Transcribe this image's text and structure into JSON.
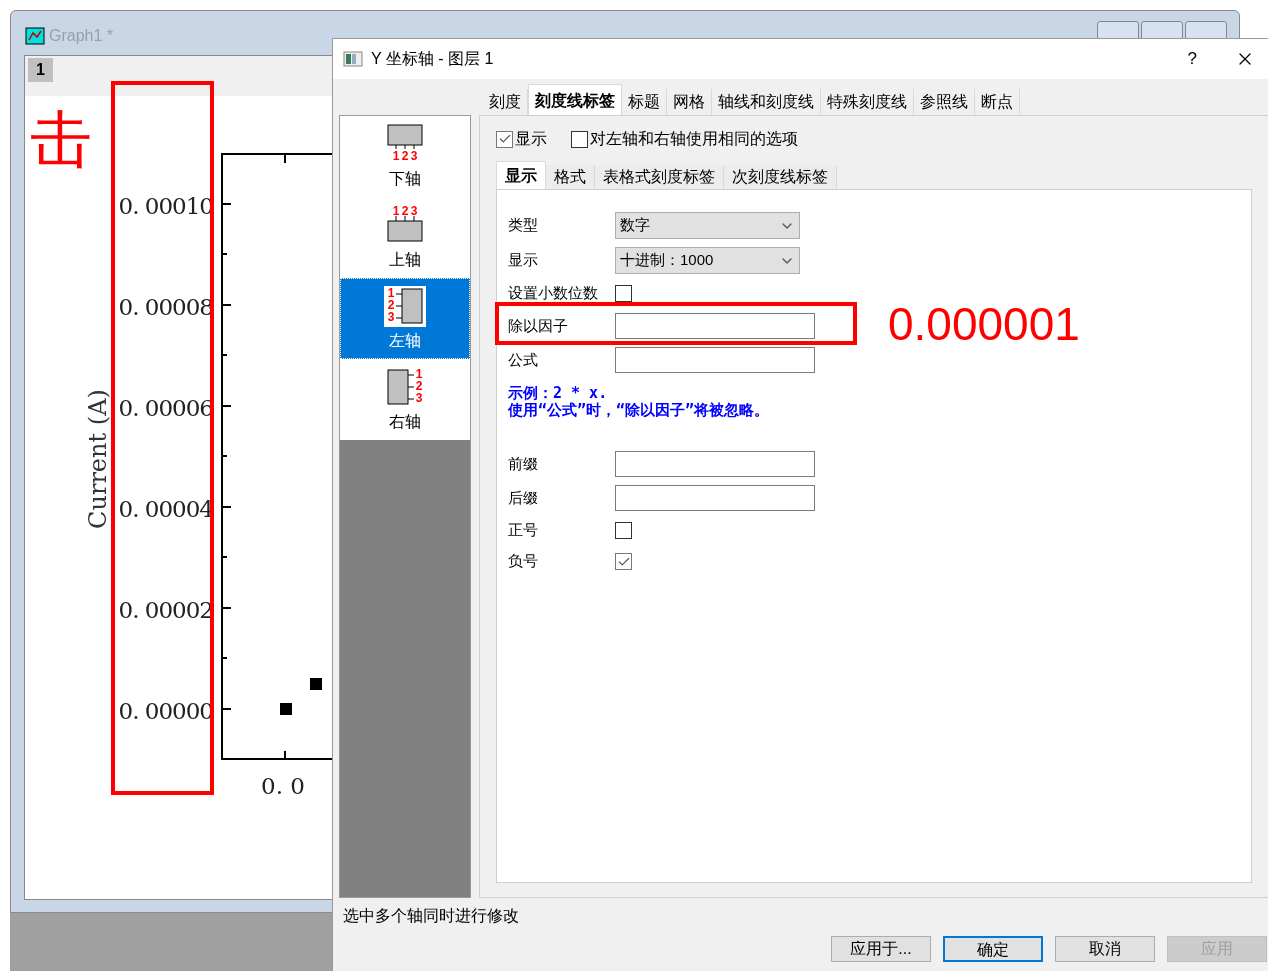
{
  "graph_window": {
    "title": "Graph1 *",
    "layer_tab": "1",
    "y_axis_title": "Current (A)",
    "y_tick_labels": [
      "0. 00010",
      "0. 00008",
      "0. 00006",
      "0. 00004",
      "0. 00002",
      "0. 00000"
    ],
    "x_tick_labels": [
      "0. 0"
    ]
  },
  "annotations": [
    {
      "kind": "text",
      "text": "击"
    },
    {
      "kind": "text",
      "text": "0.000001"
    },
    {
      "kind": "box"
    },
    {
      "kind": "box"
    }
  ],
  "dialog": {
    "title": "Y 坐标轴 - 图层 1",
    "help": "?",
    "tabs": [
      {
        "label": "刻度",
        "selected": false
      },
      {
        "label": "刻度线标签",
        "selected": true
      },
      {
        "label": "标题",
        "selected": false
      },
      {
        "label": "网格",
        "selected": false
      },
      {
        "label": "轴线和刻度线",
        "selected": false
      },
      {
        "label": "特殊刻度线",
        "selected": false
      },
      {
        "label": "参照线",
        "selected": false
      },
      {
        "label": "断点",
        "selected": false
      }
    ],
    "axes": [
      {
        "kind": "bottom",
        "digits": [
          "1",
          "2",
          "3"
        ],
        "label": "下轴",
        "selected": false
      },
      {
        "kind": "top",
        "digits": [
          "1",
          "2",
          "3"
        ],
        "label": "上轴",
        "selected": false
      },
      {
        "kind": "left",
        "digits": [
          "1",
          "2",
          "3"
        ],
        "label": "左轴",
        "selected": true
      },
      {
        "kind": "right",
        "digits": [
          "1",
          "2",
          "3"
        ],
        "label": "右轴",
        "selected": false
      }
    ],
    "show": {
      "label": "显示",
      "checked": true
    },
    "same_options": {
      "label": "对左轴和右轴使用相同的选项",
      "checked": false
    },
    "subtabs": [
      {
        "label": "显示",
        "selected": true
      },
      {
        "label": "格式",
        "selected": false
      },
      {
        "label": "表格式刻度标签",
        "selected": false
      },
      {
        "label": "次刻度线标签",
        "selected": false
      }
    ],
    "rows": [
      {
        "kind": "select",
        "label": "类型",
        "value": "数字"
      },
      {
        "kind": "select",
        "label": "显示",
        "value": "十进制：1000"
      },
      {
        "kind": "checkbox",
        "label": "设置小数位数",
        "checked": false
      },
      {
        "kind": "input",
        "label": "除以因子"
      },
      {
        "kind": "input",
        "label": "公式"
      },
      {
        "kind": "note",
        "lines": [
          "示例：2 * x.",
          "使用“公式”时，“除以因子”将被忽略。"
        ]
      },
      {
        "kind": "input",
        "label": "前缀"
      },
      {
        "kind": "input",
        "label": "后缀"
      },
      {
        "kind": "checkbox",
        "label": "正号",
        "checked": false
      },
      {
        "kind": "checkbox",
        "label": "负号",
        "checked": true
      }
    ],
    "status": "选中多个轴同时进行修改",
    "buttons": [
      {
        "label": "应用于...",
        "default": false,
        "disabled": false
      },
      {
        "label": "确定",
        "default": true,
        "disabled": false
      },
      {
        "label": "取消",
        "default": false,
        "disabled": false
      },
      {
        "label": "应用",
        "default": false,
        "disabled": true
      }
    ]
  }
}
